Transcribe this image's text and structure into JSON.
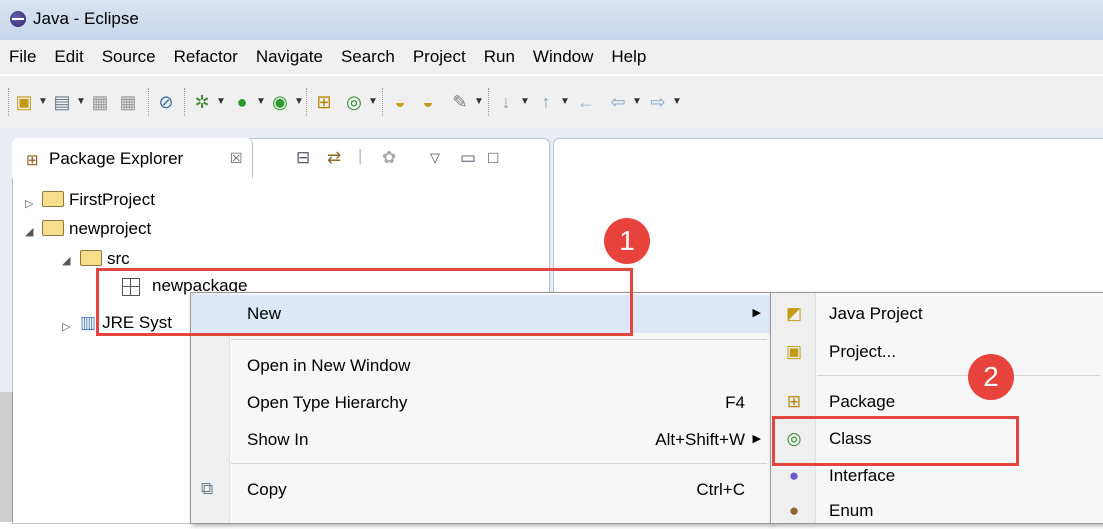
{
  "window": {
    "title": "Java - Eclipse"
  },
  "menu": [
    "File",
    "Edit",
    "Source",
    "Refactor",
    "Navigate",
    "Search",
    "Project",
    "Run",
    "Window",
    "Help"
  ],
  "explorer": {
    "tab_label": "Package Explorer",
    "tab_close_glyph": "☒",
    "tree": {
      "first_project": "FirstProject",
      "new_project": "newproject",
      "src": "src",
      "package": "newpackage",
      "jre": "JRE Syst"
    }
  },
  "context_menu": {
    "new": "New",
    "open_new_window": "Open in New Window",
    "open_type_hierarchy": "Open Type Hierarchy",
    "open_type_hierarchy_shortcut": "F4",
    "show_in": "Show In",
    "show_in_shortcut": "Alt+Shift+W",
    "copy": "Copy",
    "copy_shortcut": "Ctrl+C"
  },
  "submenu": {
    "java_project": "Java Project",
    "project": "Project...",
    "package": "Package",
    "class": "Class",
    "interface": "Interface",
    "enum": "Enum"
  },
  "annotations": {
    "step1": "1",
    "step2": "2"
  },
  "colors": {
    "annotation_red": "#e2463f",
    "highlight": "#dce8f7"
  }
}
